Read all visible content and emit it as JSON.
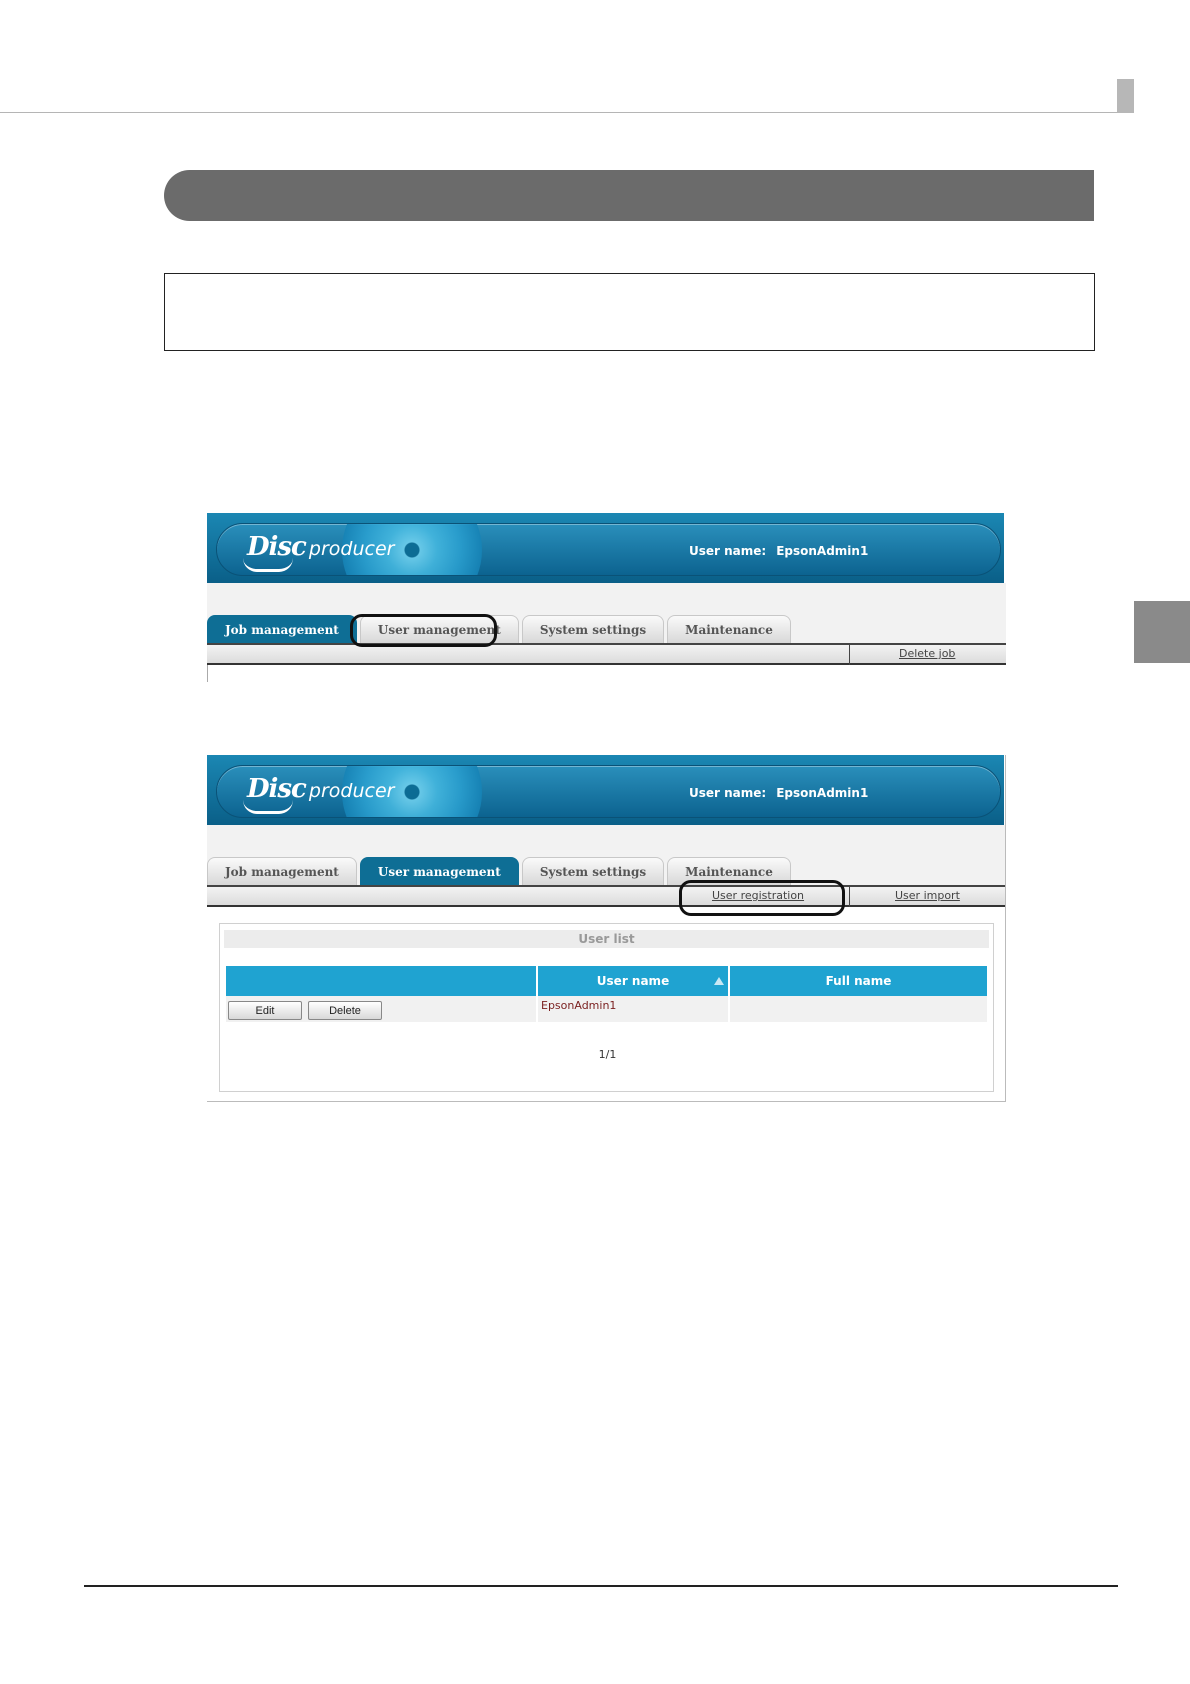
{
  "app": {
    "logo_disc": "Disc",
    "logo_producer": "producer",
    "user_name_label": "User name:",
    "user_name_value": "EpsonAdmin1"
  },
  "tabs": [
    "Job management",
    "User management",
    "System settings",
    "Maintenance"
  ],
  "screen1": {
    "active_tab": "Job management",
    "highlighted_tab": "User management",
    "subbar_links": [
      "Delete job"
    ]
  },
  "screen2": {
    "active_tab": "User management",
    "subbar_links": [
      "User registration",
      "User import"
    ],
    "highlighted_link": "User registration",
    "user_list": {
      "title": "User list",
      "columns": [
        "",
        "User name",
        "Full name"
      ],
      "sort": {
        "column": "User name",
        "direction": "ascending",
        "icon": "sort-up-triangle-icon"
      },
      "rows": [
        {
          "actions": [
            "Edit",
            "Delete"
          ],
          "user_name": "EpsonAdmin1",
          "full_name": ""
        }
      ],
      "pagination": "1/1"
    }
  },
  "colors": {
    "header_blue": "#0c6390",
    "active_tab": "#0e6e95",
    "table_header": "#1fa3d1",
    "section_bar": "#6b6b6b"
  }
}
